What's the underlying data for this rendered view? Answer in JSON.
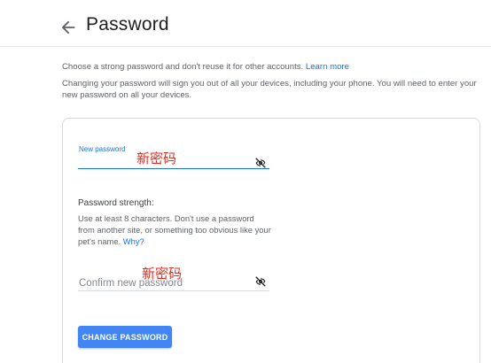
{
  "header": {
    "title": "Password"
  },
  "intro": {
    "line1": "Choose a strong password and don't reuse it for other accounts.",
    "learn_more": "Learn more",
    "line2": "Changing your password will sign you out of all your devices, including your phone. You will need to enter your new password on all your devices."
  },
  "new_password": {
    "label": "New password",
    "value": "新密码",
    "icon": "visibility-off-icon"
  },
  "strength": {
    "title": "Password strength:",
    "description": "Use at least 8 characters. Don't use a password from another site, or something too obvious like your pet's name.",
    "why_link": "Why?"
  },
  "confirm_password": {
    "placeholder": "Confirm new password",
    "value": "新密码",
    "icon": "visibility-off-icon"
  },
  "actions": {
    "change_label": "CHANGE PASSWORD"
  },
  "colors": {
    "accent": "#1a73e8",
    "button": "#4285f4",
    "annotation": "#d93025"
  }
}
